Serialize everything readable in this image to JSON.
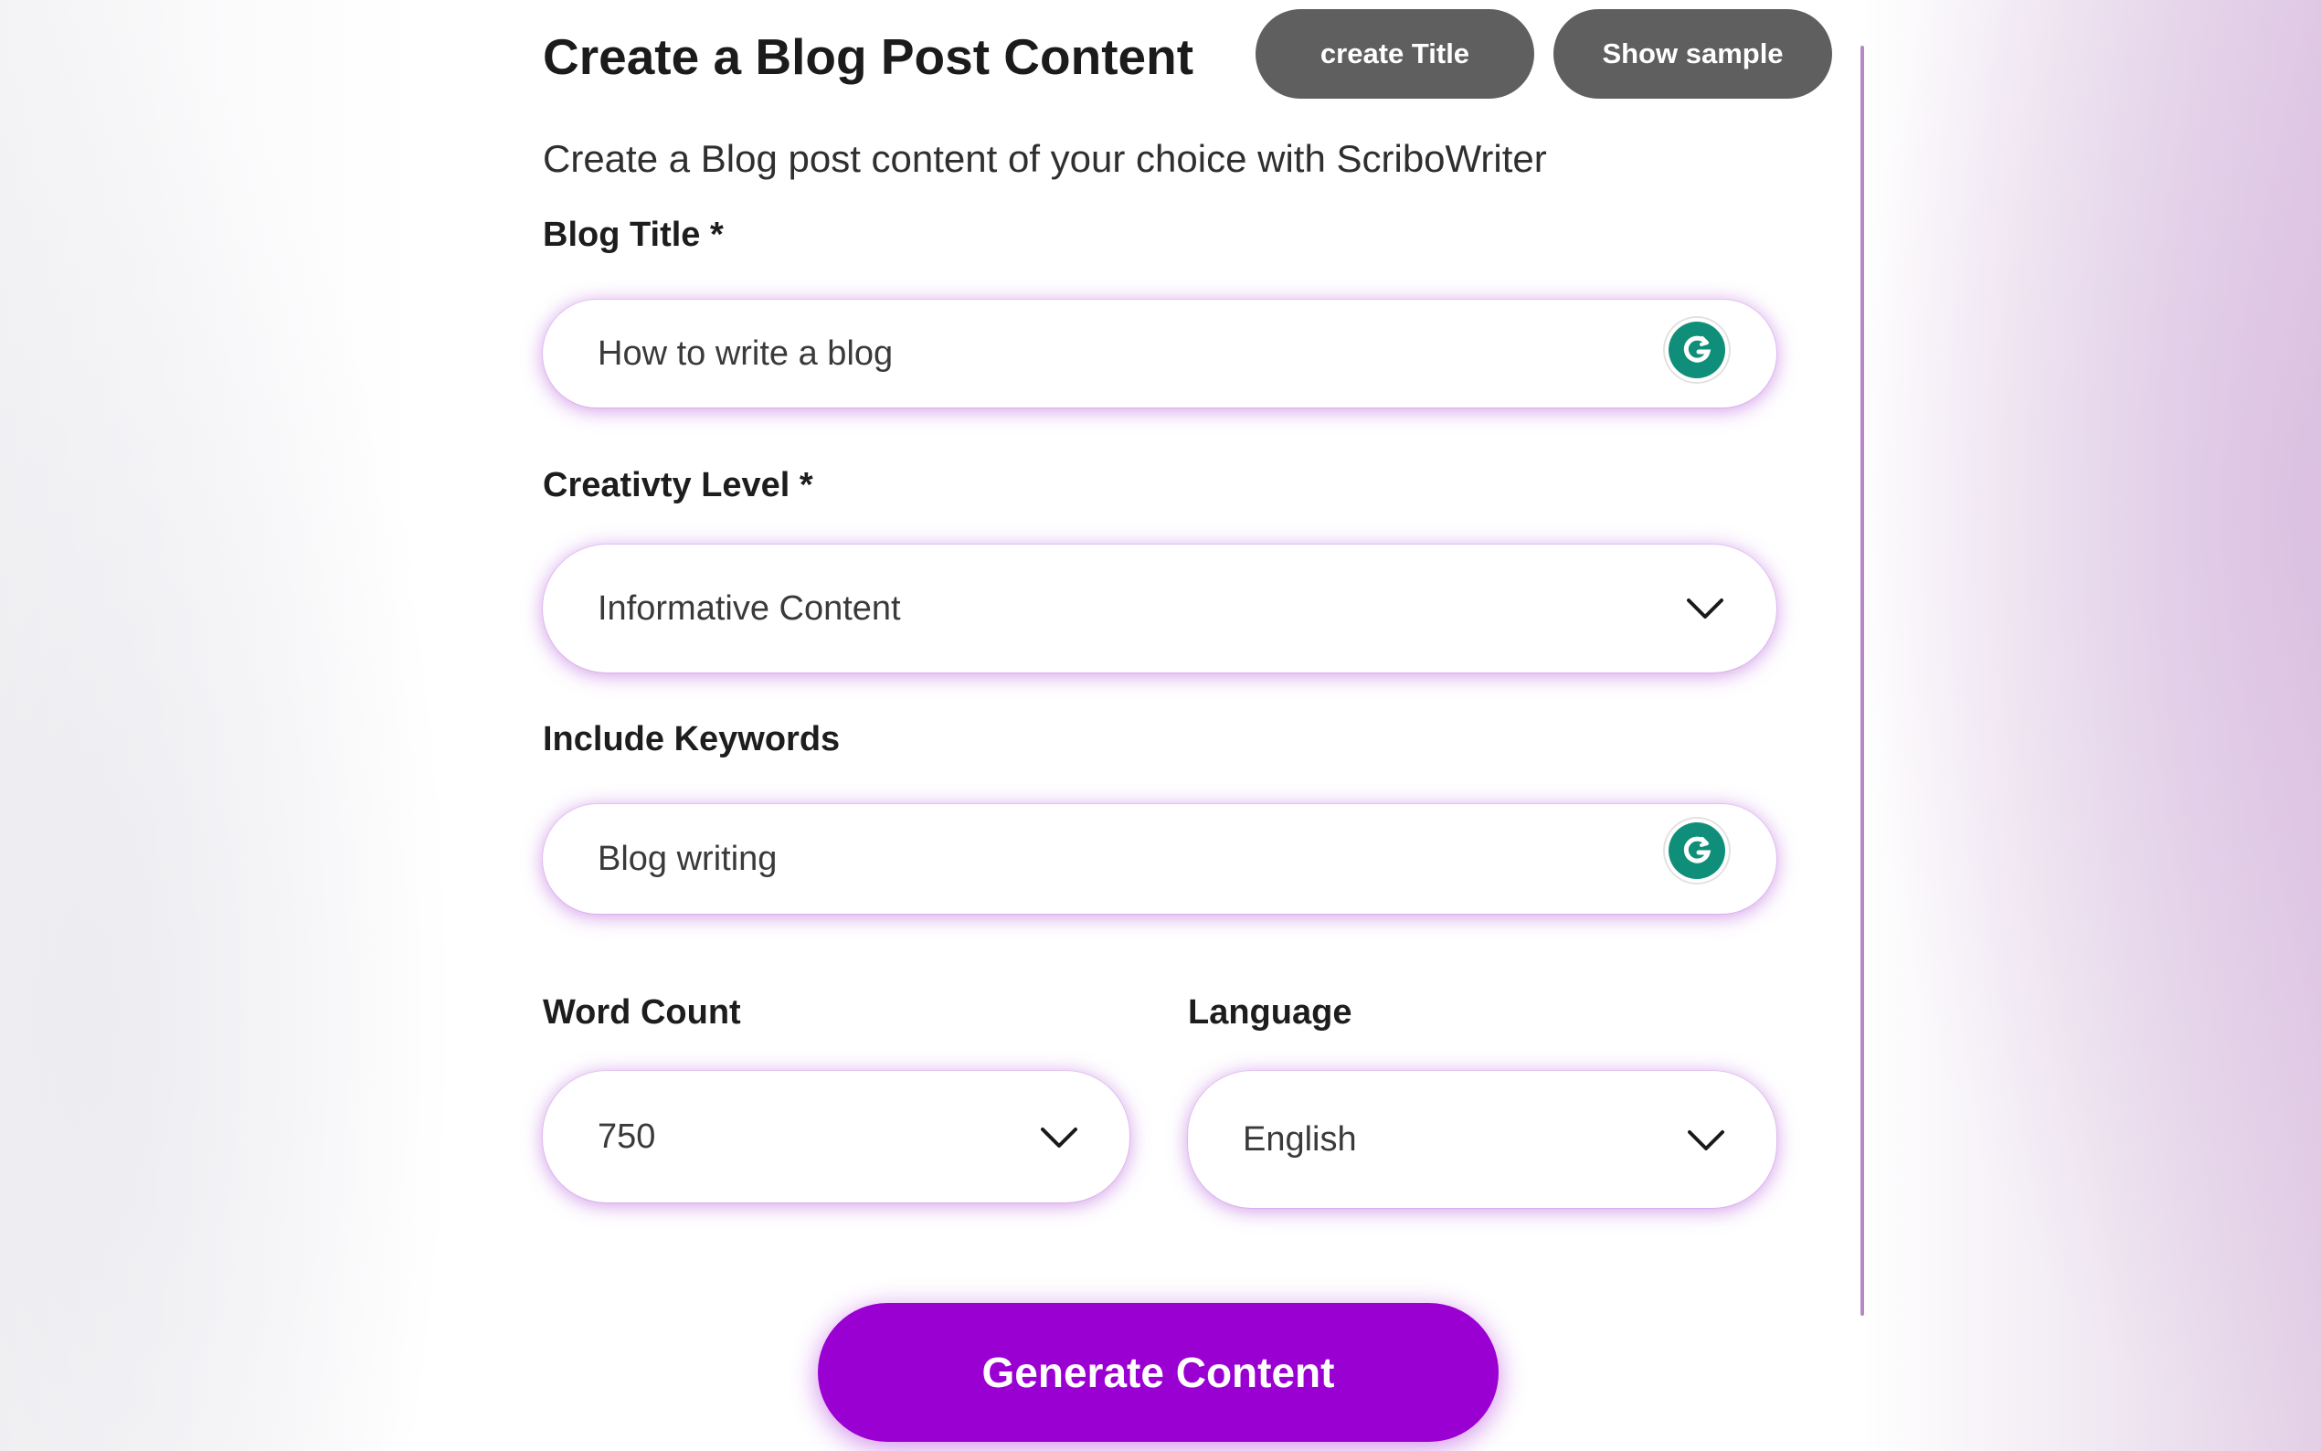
{
  "form": {
    "heading": "Create a Blog Post Content",
    "subtitle": "Create a Blog post content of your choice with ScriboWriter",
    "create_title_label": "create Title",
    "show_sample_label": "Show sample",
    "blog_title": {
      "label": "Blog Title *",
      "value": "How to write a blog",
      "icon": "grammarly-icon"
    },
    "creativity_level": {
      "label": "Creativty Level *",
      "selected": "Informative Content",
      "icon": "chevron-down-icon"
    },
    "keywords": {
      "label": "Include Keywords",
      "value": "Blog writing",
      "icon": "grammarly-icon"
    },
    "word_count": {
      "label": "Word Count",
      "selected": "750"
    },
    "language": {
      "label": "Language",
      "selected": "English"
    },
    "generate_label": "Generate Content"
  },
  "colors": {
    "accent": "#9b00d3",
    "secondary_button": "#5f5f5f",
    "grammarly": "#0f8f7a",
    "field_glow": "#ac46d6"
  }
}
